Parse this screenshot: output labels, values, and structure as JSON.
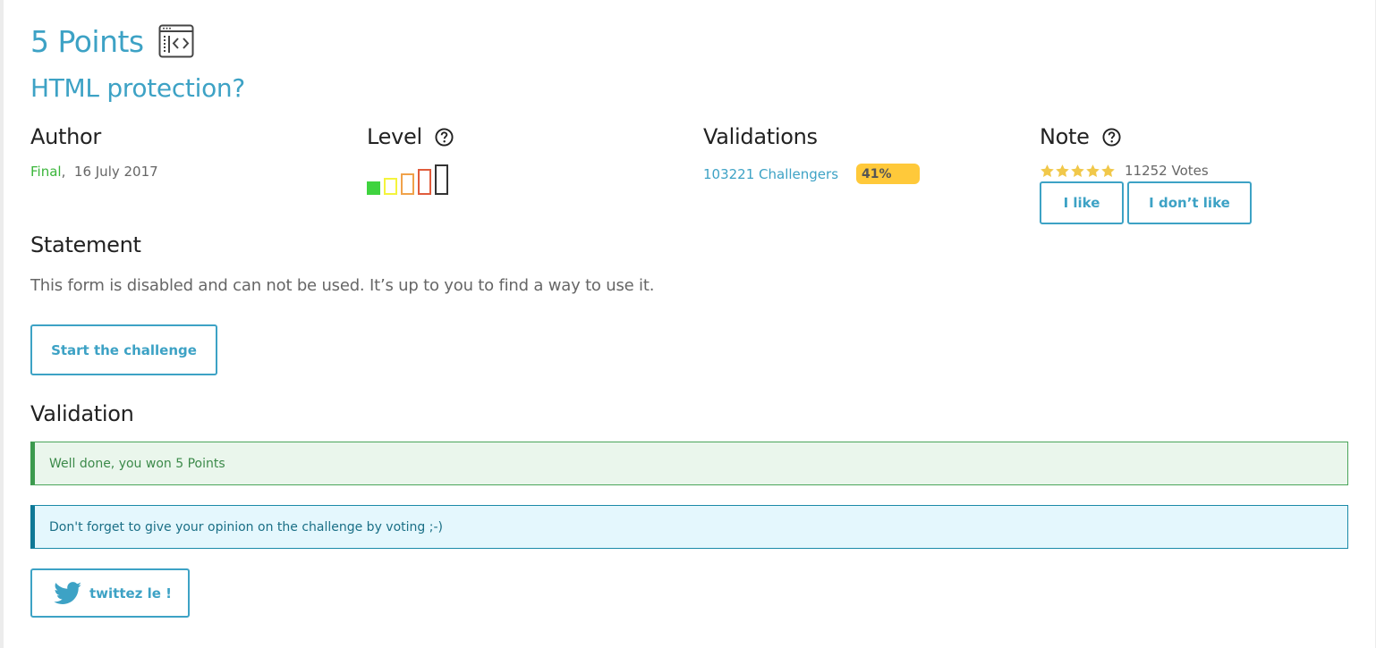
{
  "challenge": {
    "points_title": "5 Points",
    "name": "HTML protection?",
    "category_icon": "code-window-icon"
  },
  "author": {
    "heading": "Author",
    "name": "Final",
    "separator": ",",
    "date": "16 July 2017"
  },
  "level": {
    "heading": "Level",
    "help_icon": "question-circle-icon",
    "current_level": 1,
    "max_level": 5,
    "colors": [
      "#3fd33f",
      "#f4f43c",
      "#f0a24a",
      "#e05c3c",
      "#333333"
    ]
  },
  "validations": {
    "heading": "Validations",
    "challengers": "103221 Challengers",
    "percent": "41%"
  },
  "note": {
    "heading": "Note",
    "help_icon": "question-circle-icon",
    "stars": 5,
    "votes": "11252 Votes",
    "like_label": "I like",
    "dislike_label": "I don’t like"
  },
  "statement": {
    "heading": "Statement",
    "text": "This form is disabled and can not be used. It’s up to you to find a way to use it.",
    "start_label": "Start the challenge"
  },
  "validation": {
    "heading": "Validation",
    "success_message": "Well done, you won 5 Points",
    "info_message": "Don't forget to give your opinion on the challenge by voting ;-)",
    "tweet_label": "twittez le !",
    "tweet_icon": "twitter-bird-icon"
  },
  "colors": {
    "accent": "#3da2c5",
    "author_green": "#3ab53a",
    "percent_badge": "#ffc93a",
    "star": "#f1c84a",
    "success_bg": "#eaf6ec",
    "info_bg": "#e4f7fd"
  }
}
